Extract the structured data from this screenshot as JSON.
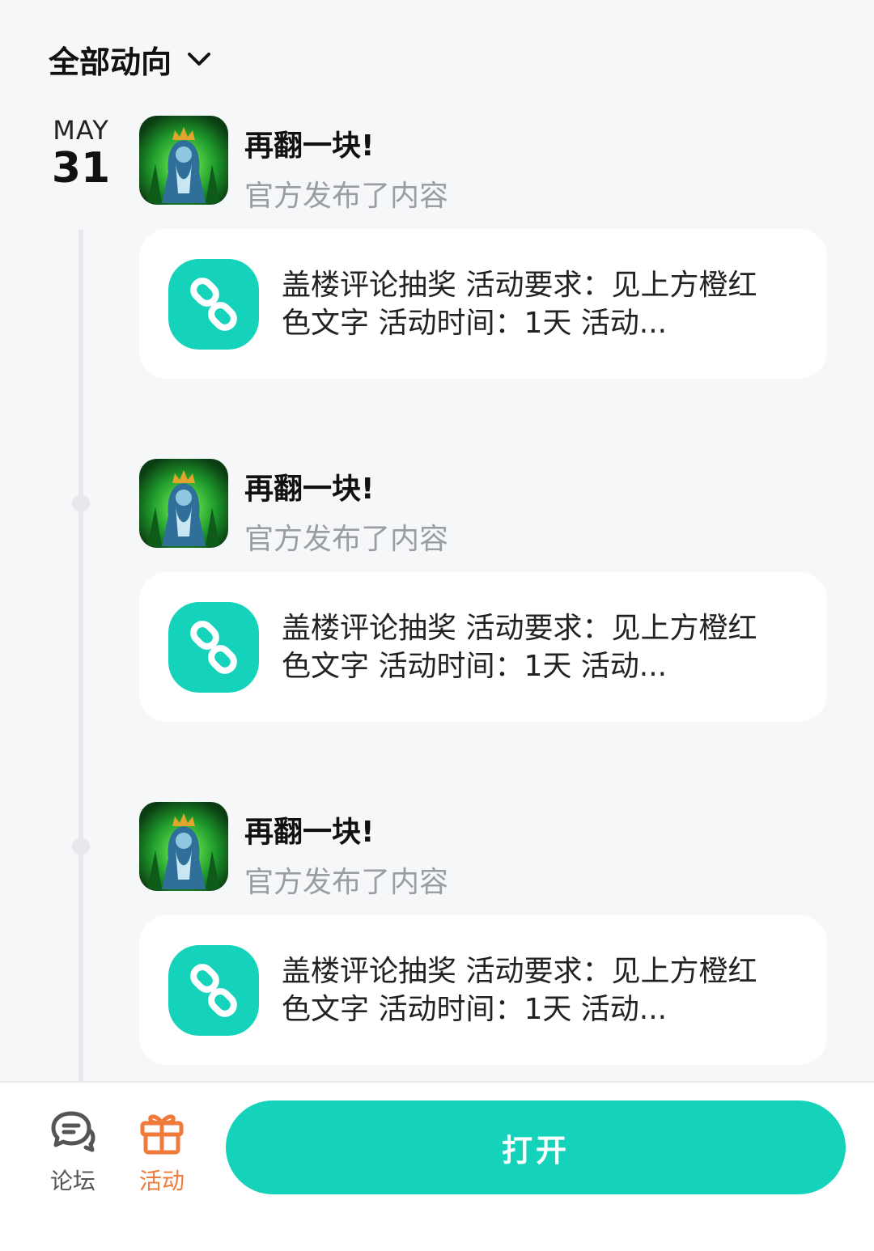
{
  "filter": {
    "label": "全部动向",
    "icon": "chevron-down-icon"
  },
  "date": {
    "month": "MAY",
    "day": "31"
  },
  "entries": [
    {
      "app_name": "再翻一块!",
      "subtitle": "官方发布了内容",
      "card_icon": "link-icon",
      "card_text": "盖楼评论抽奖 活动要求：见上方橙红色文字 活动时间：1天 活动..."
    },
    {
      "app_name": "再翻一块!",
      "subtitle": "官方发布了内容",
      "card_icon": "link-icon",
      "card_text": "盖楼评论抽奖 活动要求：见上方橙红色文字 活动时间：1天 活动..."
    },
    {
      "app_name": "再翻一块!",
      "subtitle": "官方发布了内容",
      "card_icon": "link-icon",
      "card_text": "盖楼评论抽奖 活动要求：见上方橙红色文字 活动时间：1天 活动..."
    }
  ],
  "bottom_nav": {
    "forum": {
      "label": "论坛",
      "icon": "chat-bubble-icon",
      "color": "#555555"
    },
    "activity": {
      "label": "活动",
      "icon": "gift-icon",
      "color": "#f07a3a"
    }
  },
  "open_button": {
    "label": "打开",
    "color": "#15d3bb"
  }
}
